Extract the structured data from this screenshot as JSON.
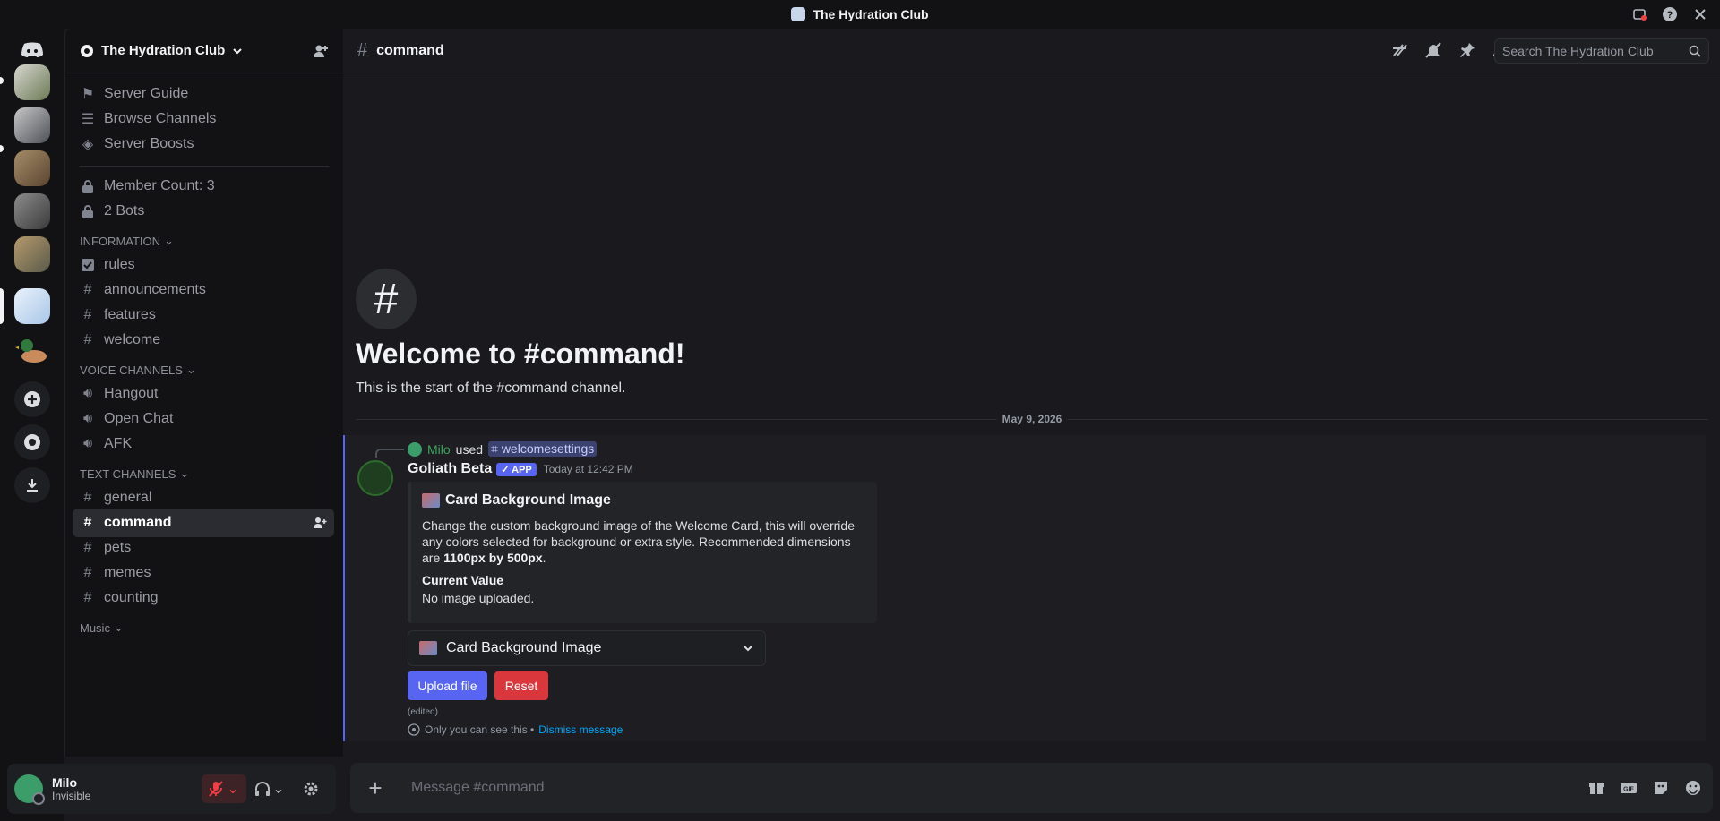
{
  "window": {
    "title": "The Hydration Club"
  },
  "server": {
    "name": "The Hydration Club",
    "nav": [
      {
        "label": "Server Guide",
        "icon": "signpost-icon"
      },
      {
        "label": "Browse Channels",
        "icon": "browse-icon"
      },
      {
        "label": "Server Boosts",
        "icon": "boost-icon"
      }
    ],
    "locked": [
      {
        "label": "Member Count: 3",
        "icon": "lock-icon"
      },
      {
        "label": "2 Bots",
        "icon": "lock-icon"
      }
    ],
    "categories": {
      "information": "INFORMATION",
      "voice": "VOICE CHANNELS",
      "text": "TEXT CHANNELS",
      "music": "Music"
    },
    "information_channels": [
      "rules",
      "announcements",
      "features",
      "welcome"
    ],
    "voice_channels": [
      "Hangout",
      "Open Chat",
      "AFK"
    ],
    "text_channels": [
      "general",
      "command",
      "pets",
      "memes",
      "counting"
    ],
    "selected_channel": "command"
  },
  "user": {
    "name": "Milo",
    "status": "Invisible"
  },
  "channel_header": {
    "name": "command",
    "search_placeholder": "Search The Hydration Club"
  },
  "welcome": {
    "heading": "Welcome to #command!",
    "subtext": "This is the start of the #command channel."
  },
  "date_divider": "May 9, 2026",
  "message": {
    "reply_user": "Milo",
    "reply_used": "used",
    "reply_command": "welcomesettings",
    "author": "Goliath Beta",
    "badge": "APP",
    "timestamp": "Today at 12:42 PM",
    "embed": {
      "title": "Card Background Image",
      "desc_part1": "Change the custom background image of the Welcome Card, this will override any colors selected for background or extra style. Recommended dimensions are ",
      "desc_bold": "1100px by 500px",
      "desc_end": ".",
      "field_name": "Current Value",
      "field_value": "No image uploaded."
    },
    "select_value": "Card Background Image",
    "upload_label": "Upload file",
    "reset_label": "Reset",
    "edited": "(edited)",
    "ephemeral_note": "Only you can see this •",
    "dismiss": "Dismiss message"
  },
  "composer": {
    "placeholder": "Message #command"
  },
  "colors": {
    "accent": "#5865f2",
    "danger": "#da373c",
    "link": "#00a8fc",
    "online_green": "#3ba55d"
  }
}
